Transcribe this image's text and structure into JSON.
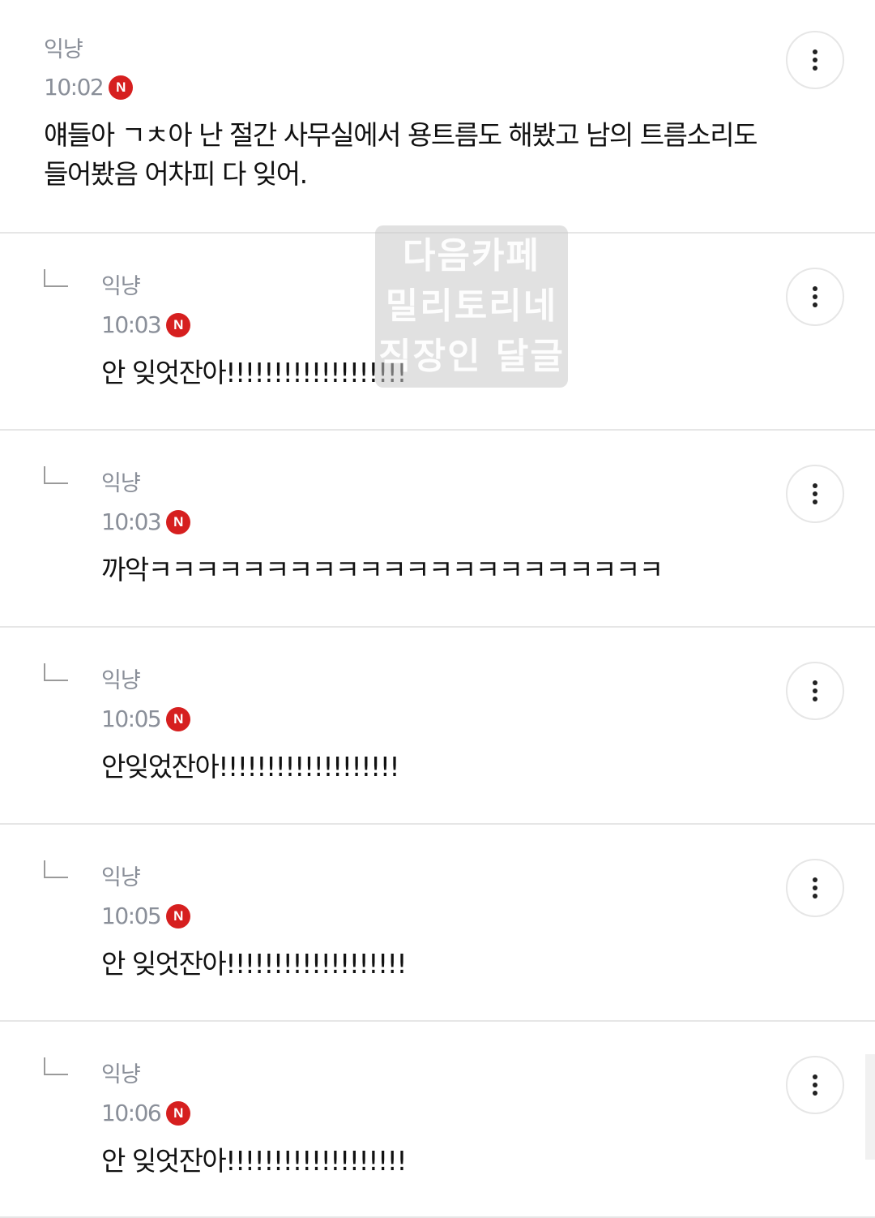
{
  "comments": [
    {
      "author": "익냥",
      "time": "10:02",
      "badge": "N",
      "text": "얘들아 ㄱㅊ아 난 절간 사무실에서 용트름도 해봤고 남의 트름소리도\n들어봤음 어차피 다 잊어.",
      "reply": false
    },
    {
      "author": "익냥",
      "time": "10:03",
      "badge": "N",
      "text": "안 잊엇잔아!!!!!!!!!!!!!!!!!!!",
      "reply": true
    },
    {
      "author": "익냥",
      "time": "10:03",
      "badge": "N",
      "text": "까악ㅋㅋㅋㅋㅋㅋㅋㅋㅋㅋㅋㅋㅋㅋㅋㅋㅋㅋㅋㅋㅋㅋ",
      "reply": true
    },
    {
      "author": "익냥",
      "time": "10:05",
      "badge": "N",
      "text": "안잊었잔아!!!!!!!!!!!!!!!!!!!",
      "reply": true
    },
    {
      "author": "익냥",
      "time": "10:05",
      "badge": "N",
      "text": "안 잊엇잔아!!!!!!!!!!!!!!!!!!!",
      "reply": true
    },
    {
      "author": "익냥",
      "time": "10:06",
      "badge": "N",
      "text": "안 잊엇잔아!!!!!!!!!!!!!!!!!!!",
      "reply": true
    }
  ],
  "watermark": {
    "lines": [
      "다음카페",
      "밀리토리네",
      "직장인 달글"
    ]
  },
  "colors": {
    "badge": "#d61f1f",
    "meta_text": "#8a8f99",
    "divider": "#e6e6e6"
  },
  "icons": {
    "more": "more-vertical-icon",
    "reply": "reply-arrow-icon"
  }
}
